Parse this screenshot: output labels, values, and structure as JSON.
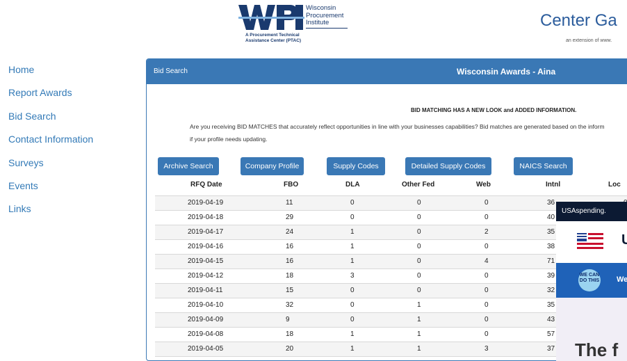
{
  "header": {
    "logo_org_line1": "Wisconsin",
    "logo_org_line2": "Procurement",
    "logo_org_line3": "Institute",
    "logo_tagline_line1": "A Procurement Technical",
    "logo_tagline_line2": "Assistance Center (PTAC)",
    "site_title": "Center Ga",
    "site_subtitle": "an extension of www."
  },
  "sidebar": {
    "items": [
      {
        "label": "Home"
      },
      {
        "label": "Report Awards"
      },
      {
        "label": "Bid Search"
      },
      {
        "label": "Contact Information"
      },
      {
        "label": "Surveys"
      },
      {
        "label": "Events"
      },
      {
        "label": "Links"
      }
    ]
  },
  "panel": {
    "heading_left": "Bid Search",
    "heading_right": "Wisconsin Awards - Aina",
    "notice_title": "BID MATCHING HAS A NEW LOOK and ADDED INFORMATION.",
    "notice_text": "Are you receiving BID MATCHES that accurately reflect opportunities in line with your businesses capabilities? Bid matches are generated based on the inform",
    "notice_text2": "if your profile needs updating.",
    "buttons": [
      {
        "label": "Archive Search"
      },
      {
        "label": "Company Profile"
      },
      {
        "label": "Supply Codes"
      },
      {
        "label": "Detailed Supply Codes"
      },
      {
        "label": "NAICS Search"
      }
    ]
  },
  "table": {
    "columns": [
      "RFQ Date",
      "FBO",
      "DLA",
      "Other Fed",
      "Web",
      "Intnl",
      "Loc"
    ],
    "rows": [
      [
        "2019-04-19",
        "11",
        "0",
        "0",
        "0",
        "36",
        "0"
      ],
      [
        "2019-04-18",
        "29",
        "0",
        "0",
        "0",
        "40",
        ""
      ],
      [
        "2019-04-17",
        "24",
        "1",
        "0",
        "2",
        "35",
        ""
      ],
      [
        "2019-04-16",
        "16",
        "1",
        "0",
        "0",
        "38",
        ""
      ],
      [
        "2019-04-15",
        "16",
        "1",
        "0",
        "4",
        "71",
        ""
      ],
      [
        "2019-04-12",
        "18",
        "3",
        "0",
        "0",
        "39",
        ""
      ],
      [
        "2019-04-11",
        "15",
        "0",
        "0",
        "0",
        "32",
        ""
      ],
      [
        "2019-04-10",
        "32",
        "0",
        "1",
        "0",
        "35",
        ""
      ],
      [
        "2019-04-09",
        "9",
        "0",
        "1",
        "0",
        "43",
        ""
      ],
      [
        "2019-04-08",
        "18",
        "1",
        "1",
        "0",
        "57",
        ""
      ],
      [
        "2019-04-05",
        "20",
        "1",
        "1",
        "3",
        "37",
        ""
      ]
    ]
  },
  "popup": {
    "bar_text": "USAspending.",
    "brand_letter": "U",
    "badge_text": "WE CAN DO THIS",
    "blue_text": "We",
    "big_text": "The f"
  },
  "colors": {
    "accent": "#3a78b5",
    "link": "#337ab7",
    "popup_dark": "#0c1a33",
    "popup_blue": "#1f62b8"
  }
}
